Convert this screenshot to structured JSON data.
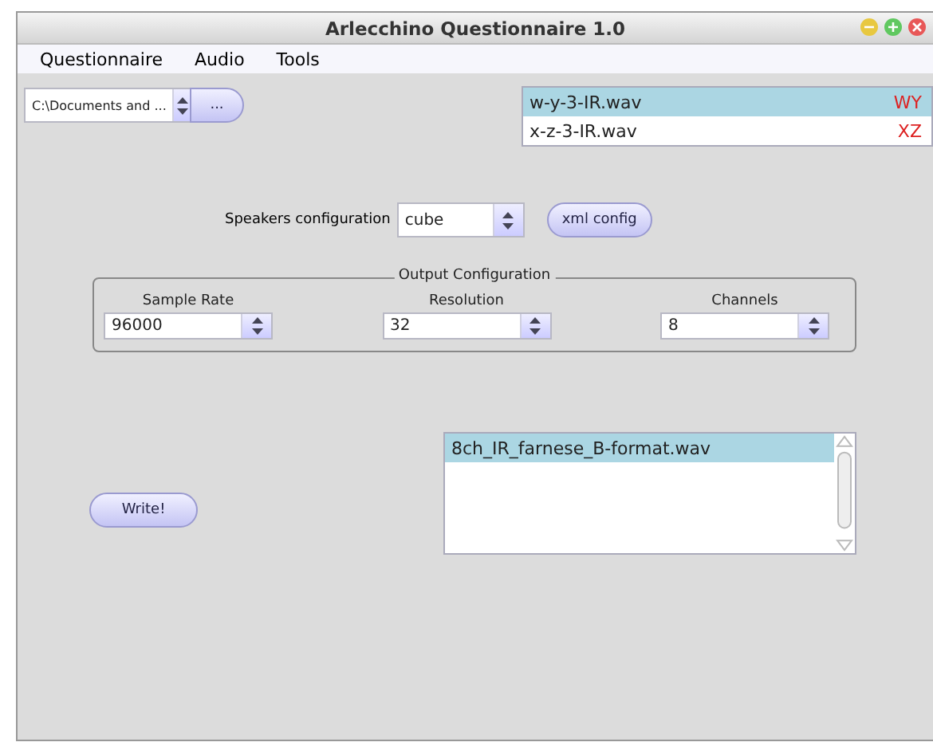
{
  "window": {
    "title": "Arlecchino Questionnaire 1.0"
  },
  "menu": [
    "Questionnaire",
    "Audio",
    "Tools"
  ],
  "path_combo": {
    "value": "C:\\Documents and ..."
  },
  "browse_button": "...",
  "ir_files": [
    {
      "name": "w-y-3-IR.wav",
      "tag": "WY",
      "selected": true
    },
    {
      "name": "x-z-3-IR.wav",
      "tag": "XZ",
      "selected": false
    }
  ],
  "speakers": {
    "label": "Speakers configuration",
    "value": "cube"
  },
  "xml_button": "xml config",
  "output": {
    "title": "Output Configuration",
    "fields": [
      {
        "label": "Sample Rate",
        "value": "96000"
      },
      {
        "label": "Resolution",
        "value": "32"
      },
      {
        "label": "Channels",
        "value": "8"
      }
    ]
  },
  "write_button": "Write!",
  "outputs": [
    {
      "name": "8ch_IR_farnese_B-format.wav",
      "selected": true
    }
  ]
}
